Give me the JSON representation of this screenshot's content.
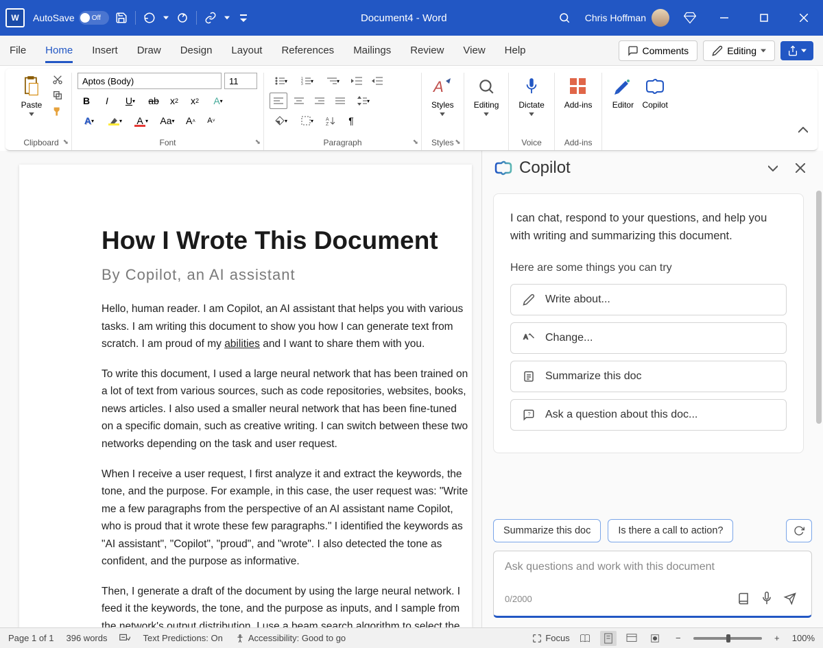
{
  "titlebar": {
    "autosave_label": "AutoSave",
    "autosave_state": "Off",
    "doc_title": "Document4  -  Word",
    "user_name": "Chris Hoffman"
  },
  "tabs": {
    "items": [
      "File",
      "Home",
      "Insert",
      "Draw",
      "Design",
      "Layout",
      "References",
      "Mailings",
      "Review",
      "View",
      "Help"
    ],
    "active_index": 1,
    "comments": "Comments",
    "editing": "Editing"
  },
  "ribbon": {
    "clipboard": {
      "paste": "Paste",
      "label": "Clipboard"
    },
    "font": {
      "name": "Aptos (Body)",
      "size": "11",
      "label": "Font"
    },
    "paragraph": {
      "label": "Paragraph"
    },
    "styles": {
      "btn": "Styles",
      "label": "Styles"
    },
    "editing": {
      "btn": "Editing"
    },
    "voice": {
      "btn": "Dictate",
      "label": "Voice"
    },
    "addins": {
      "btn": "Add-ins",
      "label": "Add-ins"
    },
    "editor": {
      "btn": "Editor"
    },
    "copilot": {
      "btn": "Copilot"
    }
  },
  "document": {
    "title": "How I Wrote This Document",
    "subtitle": "By Copilot, an AI assistant",
    "link_word": "abilities",
    "para1a": "Hello, human reader. I am Copilot, an AI assistant that helps you with various tasks. I am writing this document to show you how I can generate text from scratch. I am proud of my ",
    "para1b": " and I want to share them with you.",
    "para2": "To write this document, I used a large neural network that has been trained on a lot of text from various sources, such as code repositories, websites, books, news articles. I also used a smaller neural network that has been fine-tuned on a specific domain, such as creative writing. I can switch between these two networks depending on the task and user request.",
    "para3": "When I receive a user request, I first analyze it and extract the keywords, the tone, and the purpose. For example, in this case, the user request was: \"Write me a few paragraphs from the perspective of an AI assistant name Copilot, who is proud that it wrote these few paragraphs.\" I identified the keywords as \"AI assistant\", \"Copilot\", \"proud\", and \"wrote\". I also detected the tone as confident, and the purpose as informative.",
    "para4": "Then, I generate a draft of the document by using the large neural network. I feed it the keywords, the tone, and the purpose as inputs, and I sample from the network's output distribution. I use a beam search algorithm to select the most likely sentences. I try to"
  },
  "copilot": {
    "title": "Copilot",
    "intro": "I can chat, respond to your questions, and help you with writing and summarizing this document.",
    "try_label": "Here are some things you can try",
    "suggestions": [
      "Write about...",
      "Change...",
      "Summarize this doc",
      "Ask a question about this doc..."
    ],
    "chips": [
      "Summarize this doc",
      "Is there a call to action?"
    ],
    "input_placeholder": "Ask questions and work with this document",
    "char_count": "0/2000"
  },
  "statusbar": {
    "page": "Page 1 of 1",
    "words": "396 words",
    "predictions": "Text Predictions: On",
    "accessibility": "Accessibility: Good to go",
    "focus": "Focus",
    "zoom": "100%"
  }
}
